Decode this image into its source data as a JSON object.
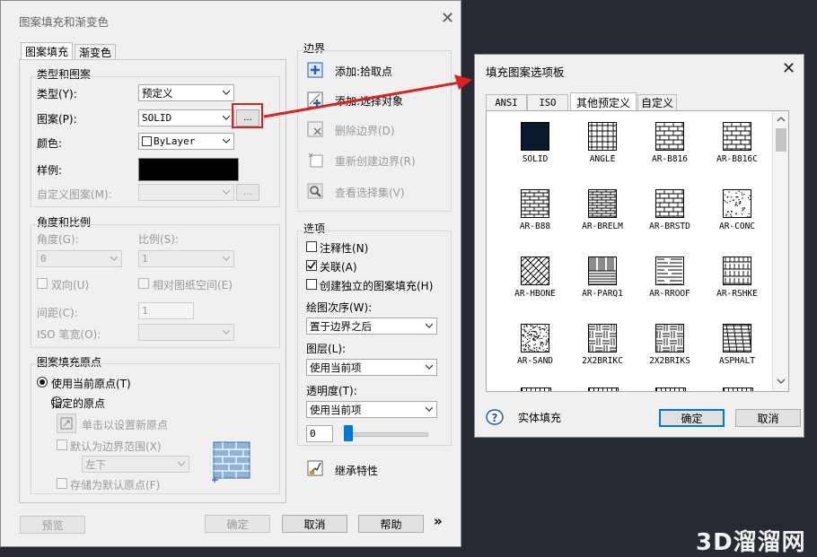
{
  "main_dialog": {
    "title": "图案填充和渐变色",
    "tabs": [
      "图案填充",
      "渐变色"
    ],
    "type_pattern": {
      "group_label": "类型和图案",
      "type_label": "类型(Y):",
      "type_value": "预定义",
      "pattern_label": "图案(P):",
      "pattern_value": "SOLID",
      "browse_button": "...",
      "color_label": "颜色:",
      "color_value": "ByLayer",
      "swatch_label": "样例:",
      "custom_label": "自定义图案(M):",
      "custom_browse": "..."
    },
    "angle_scale": {
      "group_label": "角度和比例",
      "angle_label": "角度(G):",
      "angle_value": "0",
      "scale_label": "比例(S):",
      "scale_value": "1",
      "double_label": "双向(U)",
      "relative_label": "相对图纸空间(E)",
      "spacing_label": "间距(C):",
      "spacing_value": "1",
      "iso_label": "ISO 笔宽(O):"
    },
    "origin": {
      "group_label": "图案填充原点",
      "use_current_label": "使用当前原点(T)",
      "specified_label": "指定的原点",
      "click_set_label": "单击以设置新原点",
      "default_boundary_label": "默认为边界范围(X)",
      "position_value": "左下",
      "store_default_label": "存储为默认原点(F)"
    },
    "boundary": {
      "group_label": "边界",
      "add_pick_label": "添加:拾取点",
      "add_select_label": "添加:选择对象",
      "remove_label": "删除边界(D)",
      "recreate_label": "重新创建边界(R)",
      "view_selection_label": "查看选择集(V)"
    },
    "options": {
      "group_label": "选项",
      "annotative_label": "注释性(N)",
      "associative_label": "关联(A)",
      "separate_label": "创建独立的图案填充(H)",
      "draw_order_label": "绘图次序(W):",
      "draw_order_value": "置于边界之后",
      "layer_label": "图层(L):",
      "layer_value": "使用当前项",
      "transparency_label": "透明度(T):",
      "transparency_value": "使用当前项",
      "transparency_number": "0",
      "inherit_label": "继承特性"
    },
    "footer": {
      "preview": "预览",
      "ok": "确定",
      "cancel": "取消",
      "help": "帮助",
      "expand": "»"
    }
  },
  "palette_dialog": {
    "title": "填充图案选项板",
    "tabs": [
      "ANSI",
      "ISO",
      "其他预定义",
      "自定义"
    ],
    "patterns": [
      {
        "name": "SOLID",
        "kind": "solid"
      },
      {
        "name": "ANGLE",
        "kind": "grid"
      },
      {
        "name": "AR-B816",
        "kind": "brick"
      },
      {
        "name": "AR-B816C",
        "kind": "brick"
      },
      {
        "name": "AR-B88",
        "kind": "brick-small"
      },
      {
        "name": "AR-BRELM",
        "kind": "brick-dense"
      },
      {
        "name": "AR-BRSTD",
        "kind": "brick"
      },
      {
        "name": "AR-CONC",
        "kind": "dots"
      },
      {
        "name": "AR-HBONE",
        "kind": "herringbone"
      },
      {
        "name": "AR-PARQ1",
        "kind": "parquet"
      },
      {
        "name": "AR-RROOF",
        "kind": "roof"
      },
      {
        "name": "AR-RSHKE",
        "kind": "shake"
      },
      {
        "name": "AR-SAND",
        "kind": "sand"
      },
      {
        "name": "2X2BRIKC",
        "kind": "basket"
      },
      {
        "name": "2X2BRIKS",
        "kind": "basket"
      },
      {
        "name": "ASPHALT",
        "kind": "asphalt"
      }
    ],
    "solid_fill_label": "实体填充",
    "ok": "确定",
    "cancel": "取消"
  },
  "watermark": "3D溜溜网",
  "colors": {
    "background": "#262a33",
    "solid_swatch": "#0a1a2c",
    "highlight_red": "#e02020",
    "accent_blue": "#0078d7"
  }
}
